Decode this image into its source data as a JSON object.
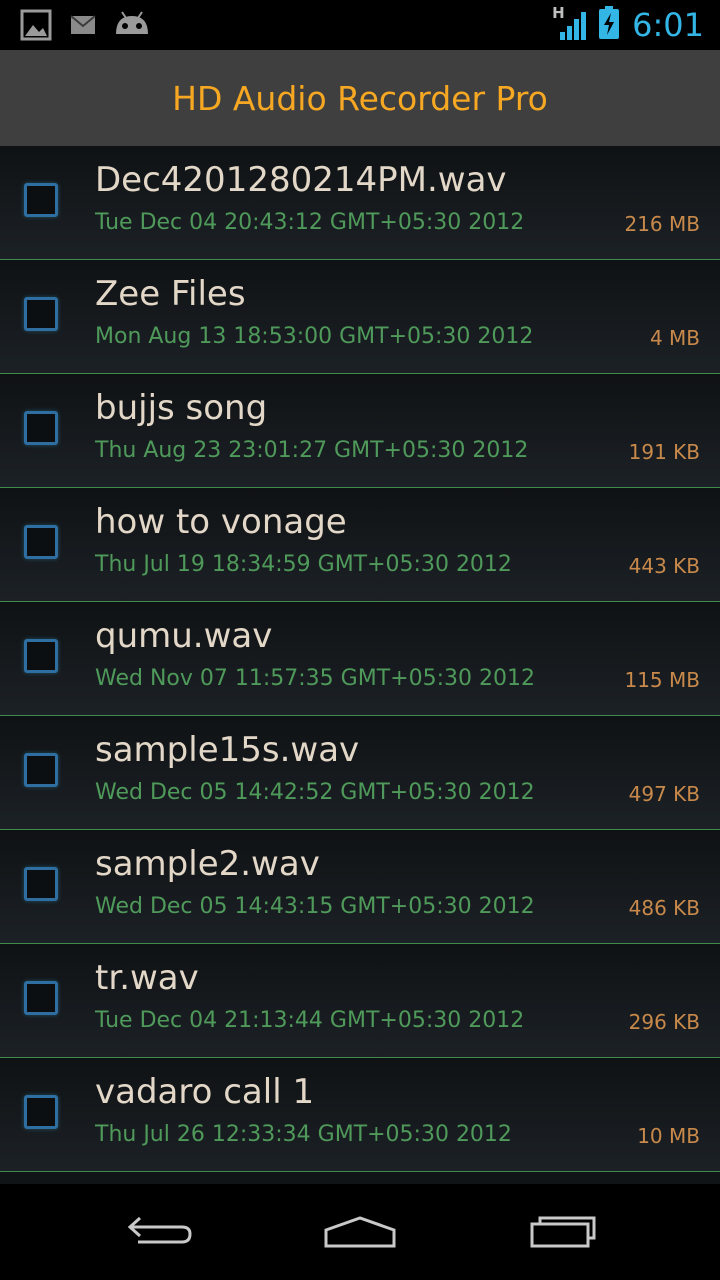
{
  "status_bar": {
    "left_icons": [
      "picture-icon",
      "gmail-icon",
      "android-icon"
    ],
    "right_icons": [
      "signal-h-icon",
      "battery-charging-icon"
    ],
    "network_type": "H",
    "time": "6:01"
  },
  "app": {
    "title": "HD Audio Recorder Pro"
  },
  "files": [
    {
      "name": "Dec4201280214PM.wav",
      "date": "Tue Dec 04 20:43:12 GMT+05:30 2012",
      "size": "216 MB"
    },
    {
      "name": "Zee Files",
      "date": "Mon Aug 13 18:53:00 GMT+05:30 2012",
      "size": "4 MB"
    },
    {
      "name": "bujjs song",
      "date": "Thu Aug 23 23:01:27 GMT+05:30 2012",
      "size": "191 KB"
    },
    {
      "name": "how to vonage",
      "date": "Thu Jul 19 18:34:59 GMT+05:30 2012",
      "size": "443 KB"
    },
    {
      "name": "qumu.wav",
      "date": "Wed Nov 07 11:57:35 GMT+05:30 2012",
      "size": "115 MB"
    },
    {
      "name": "sample15s.wav",
      "date": "Wed Dec 05 14:42:52 GMT+05:30 2012",
      "size": "497 KB"
    },
    {
      "name": "sample2.wav",
      "date": "Wed Dec 05 14:43:15 GMT+05:30 2012",
      "size": "486 KB"
    },
    {
      "name": "tr.wav",
      "date": "Tue Dec 04 21:13:44 GMT+05:30 2012",
      "size": "296 KB"
    },
    {
      "name": "vadaro call 1",
      "date": "Thu Jul 26 12:33:34 GMT+05:30 2012",
      "size": "10 MB"
    }
  ],
  "nav_bar": {
    "buttons": [
      "back-icon",
      "home-icon",
      "recent-apps-icon"
    ]
  },
  "colors": {
    "accent": "#33b5e5",
    "title": "#f7a823",
    "file_name": "#e3d7c8",
    "date": "#4f9a5a",
    "size": "#c8894a",
    "divider": "#3f8a4c"
  }
}
